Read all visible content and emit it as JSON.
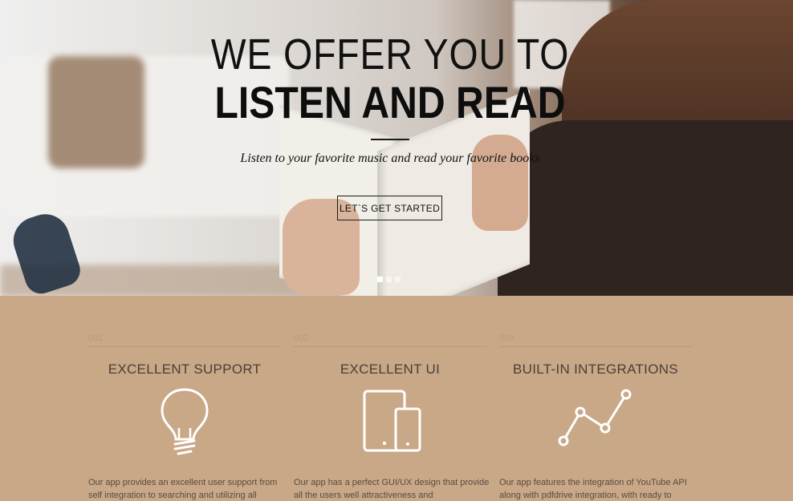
{
  "hero": {
    "title_light": "WE OFFER YOU TO",
    "title_bold": "LISTEN AND READ",
    "subtitle": "Listen to your favorite music and read your favorite books",
    "cta_label": "LET`S GET STARTED",
    "slides": 3,
    "active_slide": 1
  },
  "features": [
    {
      "number": "001",
      "title": "EXCELLENT SUPPORT",
      "icon": "lightbulb-icon",
      "text": "Our app provides an excellent user support from self integration to searching and utilizing all"
    },
    {
      "number": "002",
      "title": "EXCELLENT UI",
      "icon": "devices-icon",
      "text": "Our app has a perfect GUI/UX design that provide all the users well attractiveness and"
    },
    {
      "number": "003",
      "title": "BUILT-IN INTEGRATIONS",
      "icon": "line-chart-icon",
      "text": "Our app features the integration of YouTube API along with pdfdrive integration, with ready to"
    }
  ],
  "colors": {
    "features_background": "#c8a887",
    "title_text": "#4a3f37",
    "body_text": "#5b4b3f"
  }
}
